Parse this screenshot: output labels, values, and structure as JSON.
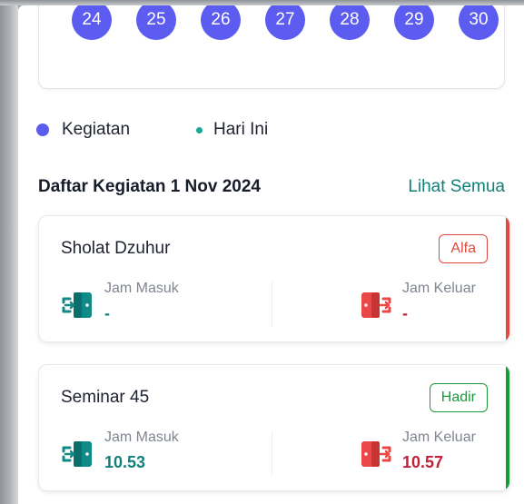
{
  "calendar": {
    "days": [
      "24",
      "25",
      "26",
      "27",
      "28",
      "29",
      "30"
    ]
  },
  "legend": {
    "activity_label": "Kegiatan",
    "today_label": "Hari Ini"
  },
  "activities_section": {
    "title": "Daftar Kegiatan 1 Nov 2024",
    "see_all_label": "Lihat Semua"
  },
  "activities": [
    {
      "name": "Sholat Dzuhur",
      "status": "Alfa",
      "check_in_label": "Jam Masuk",
      "check_in_value": "-",
      "check_out_label": "Jam Keluar",
      "check_out_value": "-"
    },
    {
      "name": "Seminar 45",
      "status": "Hadir",
      "check_in_label": "Jam Masuk",
      "check_in_value": "10.53",
      "check_out_label": "Jam Keluar",
      "check_out_value": "10.57"
    }
  ],
  "colors": {
    "primary": "#5c5cf0",
    "teal": "#12807a",
    "absent": "#e2483d",
    "present": "#1a9a3a",
    "checkout": "#c0203a"
  },
  "icons": {
    "check_in": "door-enter-icon",
    "check_out": "door-exit-icon"
  }
}
